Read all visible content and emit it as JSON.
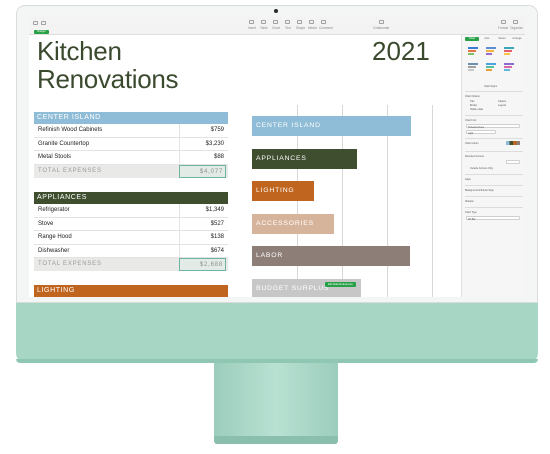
{
  "document": {
    "title_line1": "Kitchen",
    "title_line2": "Renovations",
    "year": "2021"
  },
  "toolbar": {
    "items": [
      "Insert",
      "Table",
      "Chart",
      "Text",
      "Shape",
      "Media",
      "Comment"
    ],
    "collaborate": "Collaborate",
    "format": "Format",
    "organize": "Organize",
    "sheet_tab": "Budget"
  },
  "tables": [
    {
      "header": "CENTER ISLAND",
      "color": "#8fbcd6",
      "rows": [
        {
          "name": "Refinish Wood Cabinets",
          "value": "$759"
        },
        {
          "name": "Granite Countertop",
          "value": "$3,230"
        },
        {
          "name": "Metal Stools",
          "value": "$88"
        }
      ],
      "total_label": "TOTAL EXPENSES",
      "total_value": "$4,077"
    },
    {
      "header": "APPLIANCES",
      "color": "#3e4e2e",
      "rows": [
        {
          "name": "Refrigerator",
          "value": "$1,349"
        },
        {
          "name": "Stove",
          "value": "$527"
        },
        {
          "name": "Range Hood",
          "value": "$138"
        },
        {
          "name": "Dishwasher",
          "value": "$674"
        }
      ],
      "total_label": "TOTAL EXPENSES",
      "total_value": "$2,688"
    },
    {
      "header": "LIGHTING",
      "color": "#c0651f"
    }
  ],
  "chart_data": {
    "type": "bar",
    "orientation": "horizontal",
    "categories": [
      "CENTER ISLAND",
      "APPLIANCES",
      "LIGHTING",
      "ACCESSORIES",
      "LABOR",
      "BUDGET SURPLUS"
    ],
    "values": [
      4077,
      2688,
      1600,
      2100,
      4050,
      2800
    ],
    "colors": [
      "#8fbcd6",
      "#3e4e2e",
      "#c0651f",
      "#d6b49c",
      "#8d7f77",
      "#c7c7c7"
    ],
    "xlim": [
      0,
      5000
    ],
    "grid": true
  },
  "sidebar": {
    "tabs": [
      "Chart",
      "Axis",
      "Series",
      "Arrange"
    ],
    "labels": [
      "Chart Styles",
      "Chart Options",
      "Title",
      "Caption",
      "Border",
      "Legend",
      "Hidden data",
      "Chart Font",
      "Chart Colors",
      "Rounded Corners",
      "Outside Corners Only",
      "Gaps",
      "Background & Border Style",
      "Shadow",
      "Chart Type"
    ],
    "font_value": "Helvetica Neue",
    "weight_value": "Light",
    "type_value": "2D Bar"
  },
  "chart_badge": "Edit Data References"
}
